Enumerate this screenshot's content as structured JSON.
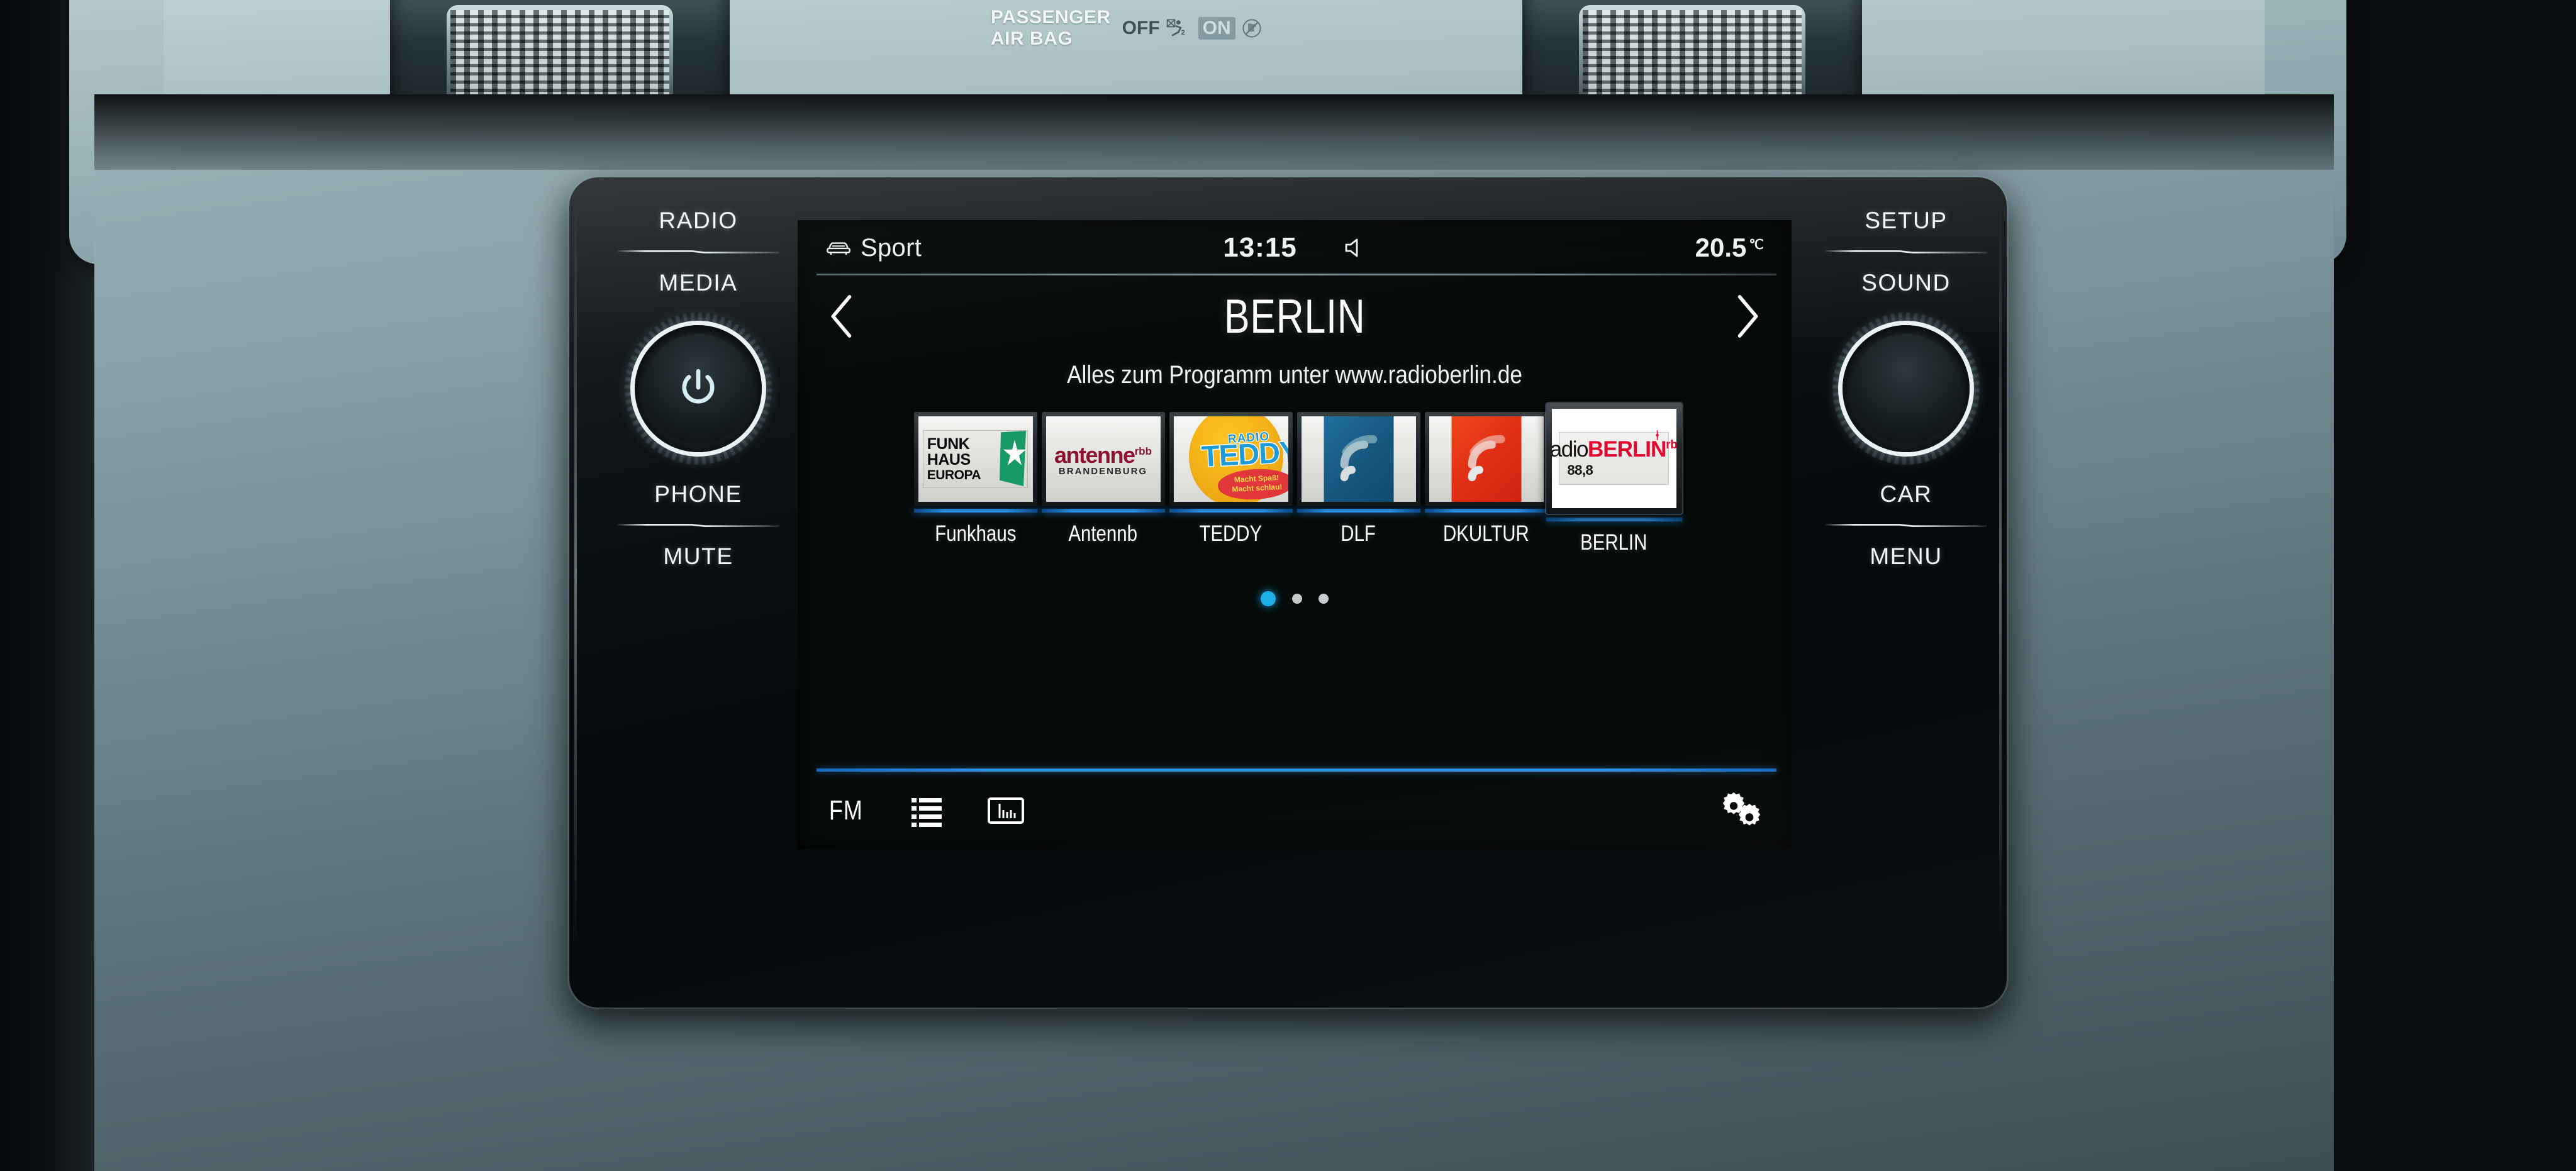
{
  "dashboard": {
    "airbag": {
      "title_line1": "PASSENGER",
      "title_line2": "AIR BAG",
      "off_label": "OFF",
      "on_label": "ON",
      "off_icon": "airbag-disabled-icon",
      "on_icon": "child-seat-crossed-icon"
    },
    "left_controls": [
      {
        "id": "radio",
        "label": "RADIO"
      },
      {
        "id": "media",
        "label": "MEDIA"
      },
      {
        "id": "phone",
        "label": "PHONE"
      },
      {
        "id": "mute",
        "label": "MUTE"
      }
    ],
    "right_controls": [
      {
        "id": "setup",
        "label": "SETUP"
      },
      {
        "id": "sound",
        "label": "SOUND"
      },
      {
        "id": "car",
        "label": "CAR"
      },
      {
        "id": "menu",
        "label": "MENU"
      }
    ],
    "left_knob": {
      "name": "power-volume-knob",
      "icon": "power-icon"
    },
    "right_knob": {
      "name": "tune-knob",
      "icon": ""
    }
  },
  "screen": {
    "statusbar": {
      "mode_icon": "car-front-icon",
      "mode_label": "Sport",
      "clock": "13:15",
      "speaker_icon": "speaker-icon",
      "temperature": "20.5",
      "temperature_unit": "℃"
    },
    "header": {
      "prev_icon": "chevron-left-icon",
      "next_icon": "chevron-right-icon",
      "station_name": "BERLIN",
      "radiotext": "Alles zum Programm unter www.radioberlin.de"
    },
    "presets": [
      {
        "label": "Funkhaus",
        "logo": "funkhaus-europa-logo",
        "logo_text": {
          "l1": "FUNK",
          "l2": "HAUS",
          "l3": "EUROPA"
        },
        "selected": false
      },
      {
        "label": "Antennb",
        "logo": "antenne-brandenburg-logo",
        "logo_text": {
          "name": "antenne",
          "sup": "rbb",
          "sub": "BRANDENBURG"
        },
        "selected": false
      },
      {
        "label": "TEDDY",
        "logo": "radio-teddy-logo",
        "logo_text": {
          "radio": "RADIO",
          "name": "TEDDY",
          "slogan1": "Macht Spaß!",
          "slogan2": "Macht schlau!"
        },
        "selected": false
      },
      {
        "label": "DLF",
        "logo": "deutschlandfunk-wave-logo",
        "logo_color": "#1f6f9e",
        "selected": false
      },
      {
        "label": "DKULTUR",
        "logo": "deutschlandfunk-kultur-wave-logo",
        "logo_color": "#e02f15",
        "selected": false
      },
      {
        "label": "BERLIN",
        "logo": "radio-berlin-rbb-logo",
        "logo_text": {
          "radio": "radio",
          "name": "BERLIN",
          "sup": "rbb",
          "freq": "88,8"
        },
        "selected": true
      }
    ],
    "pager": {
      "total": 3,
      "active_index": 0
    },
    "toolbar": [
      {
        "id": "band",
        "label": "FM",
        "icon": ""
      },
      {
        "id": "list",
        "label": "",
        "icon": "station-list-icon"
      },
      {
        "id": "manual",
        "label": "",
        "icon": "frequency-scale-icon"
      },
      {
        "id": "settings",
        "label": "",
        "icon": "gears-icon"
      }
    ]
  },
  "colors": {
    "accent_blue": "#2f91e4",
    "active_dot": "#1eaee8",
    "screen_bg": "#050a09"
  }
}
